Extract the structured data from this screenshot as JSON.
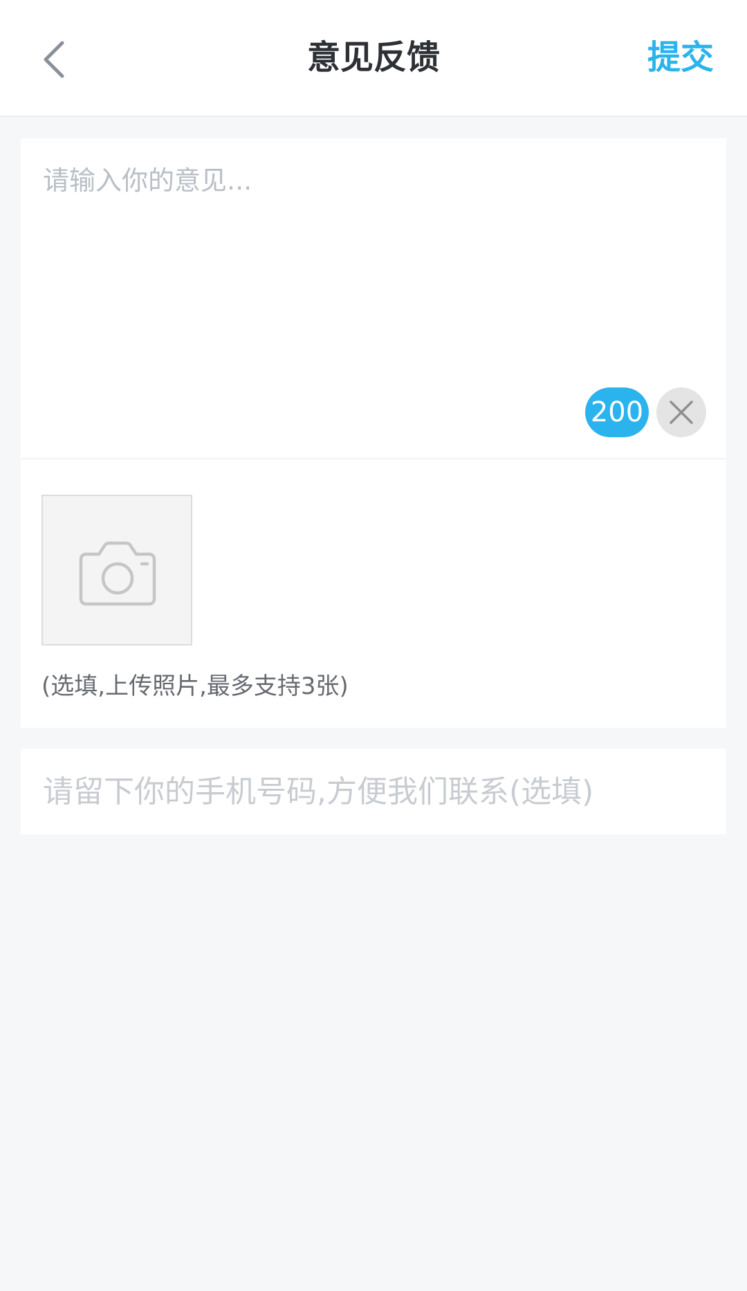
{
  "header": {
    "back_icon": "chevron-left-icon",
    "title": "意见反馈",
    "submit_label": "提交"
  },
  "feedback": {
    "placeholder": "请输入你的意见...",
    "value": "",
    "char_count": "200",
    "clear_icon": "close-icon"
  },
  "photos": {
    "upload_icon": "camera-icon",
    "hint": "(选填,上传照片,最多支持3张)"
  },
  "phone": {
    "placeholder": "请留下你的手机号码,方便我们联系(选填)",
    "value": ""
  },
  "colors": {
    "accent": "#2bb3ee",
    "background": "#f6f7f9",
    "card": "#ffffff"
  }
}
